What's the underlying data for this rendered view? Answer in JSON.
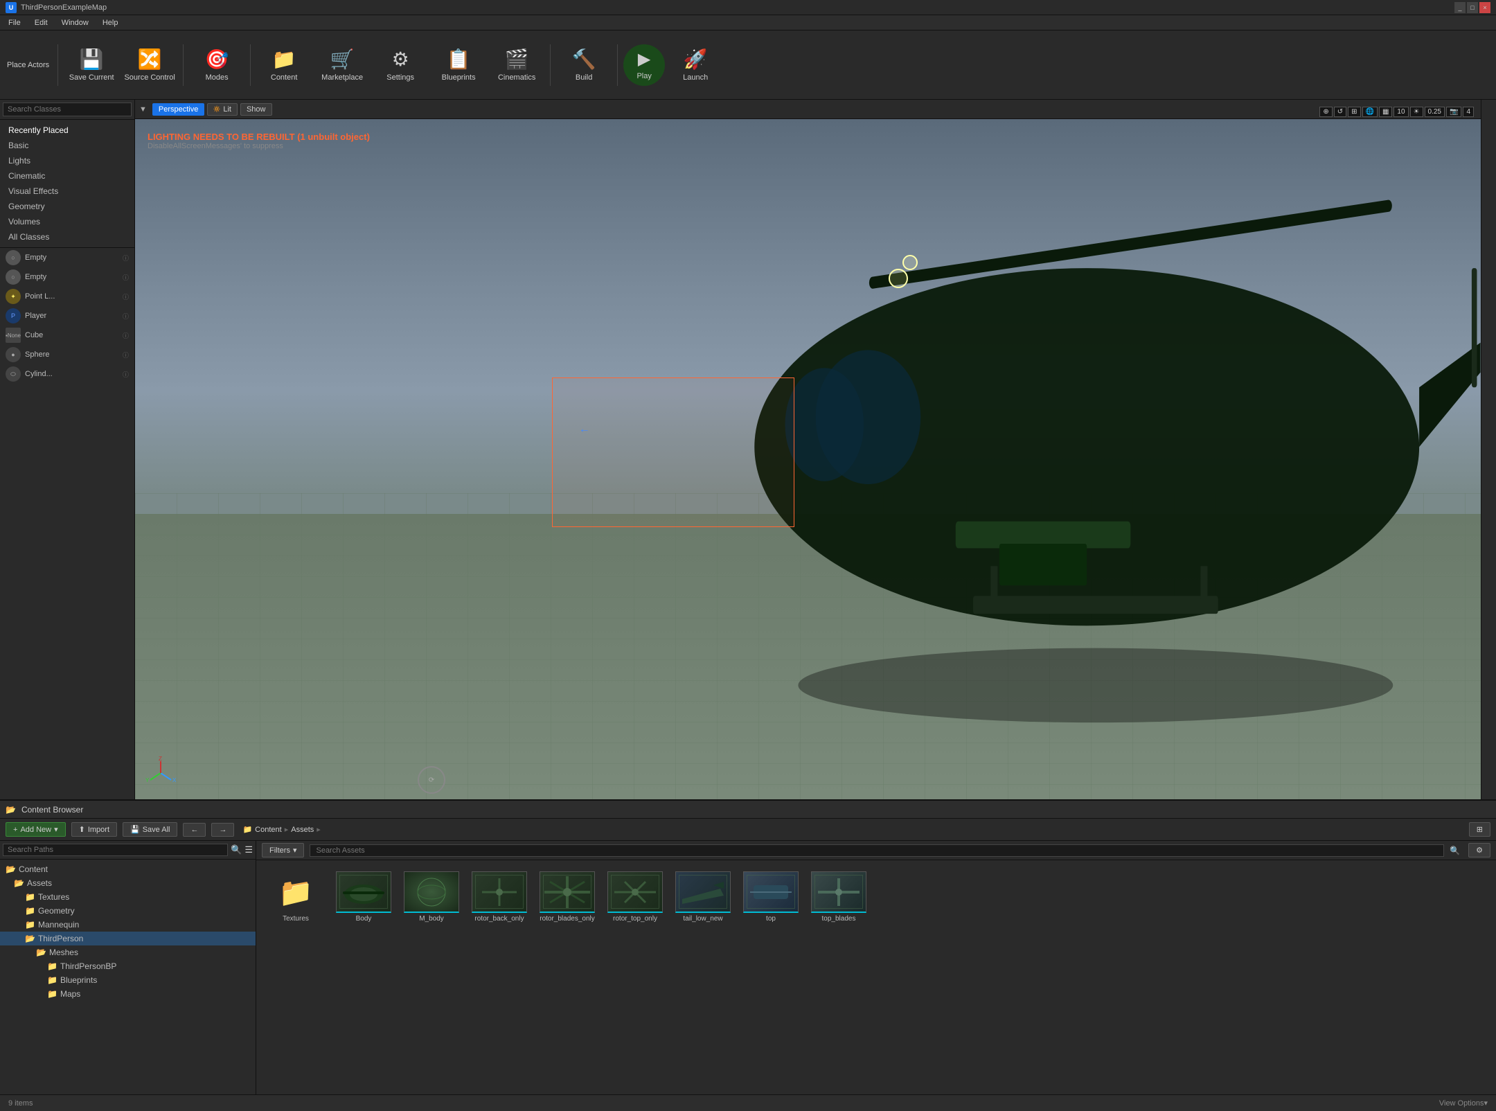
{
  "titlebar": {
    "logo": "UE",
    "title": "ThirdPersonExampleMap",
    "controls": [
      "_",
      "□",
      "×"
    ]
  },
  "menubar": {
    "items": [
      "File",
      "Edit",
      "Window",
      "Help"
    ]
  },
  "toolbar": {
    "place_actors_label": "Place Actors",
    "buttons": [
      {
        "id": "save-current",
        "label": "Save Current",
        "icon": "💾"
      },
      {
        "id": "source-control",
        "label": "Source Control",
        "icon": "🔀"
      },
      {
        "id": "modes",
        "label": "Modes",
        "icon": "🎯"
      },
      {
        "id": "content",
        "label": "Content",
        "icon": "📁"
      },
      {
        "id": "marketplace",
        "label": "Marketplace",
        "icon": "🛒"
      },
      {
        "id": "settings",
        "label": "Settings",
        "icon": "⚙"
      },
      {
        "id": "blueprints",
        "label": "Blueprints",
        "icon": "📋"
      },
      {
        "id": "cinematics",
        "label": "Cinematics",
        "icon": "🎬"
      },
      {
        "id": "build",
        "label": "Build",
        "icon": "🔨"
      },
      {
        "id": "play",
        "label": "Play",
        "icon": "▶"
      },
      {
        "id": "launch",
        "label": "Launch",
        "icon": "🚀"
      }
    ]
  },
  "left_panel": {
    "search_placeholder": "Search Classes",
    "categories": [
      {
        "id": "recently-placed",
        "label": "Recently Placed"
      },
      {
        "id": "basic",
        "label": "Basic"
      },
      {
        "id": "lights",
        "label": "Lights"
      },
      {
        "id": "cinematic",
        "label": "Cinematic"
      },
      {
        "id": "visual-effects",
        "label": "Visual Effects"
      },
      {
        "id": "geometry",
        "label": "Geometry"
      },
      {
        "id": "volumes",
        "label": "Volumes"
      },
      {
        "id": "all-classes",
        "label": "All Classes"
      }
    ],
    "actors": [
      {
        "id": "empty-1",
        "label": "Empty",
        "type": "sphere"
      },
      {
        "id": "empty-2",
        "label": "Empty",
        "type": "sphere"
      },
      {
        "id": "point-light",
        "label": "Point L...",
        "type": "sphere"
      },
      {
        "id": "player",
        "label": "Player",
        "type": "sphere"
      },
      {
        "id": "cube",
        "label": "Cube",
        "type": "cube"
      },
      {
        "id": "sphere",
        "label": "Sphere",
        "type": "sphere"
      },
      {
        "id": "cylinder",
        "label": "Cylind...",
        "type": "sphere"
      }
    ]
  },
  "viewport": {
    "perspective_label": "Perspective",
    "lit_label": "Lit",
    "show_label": "Show",
    "warning_text": "LIGHTING NEEDS TO BE REBUILT (1 unbuilt object)",
    "warning_sub": "DisableAllScreenMessages' to suppress",
    "overlay_values": [
      "10",
      "0.25",
      "4"
    ]
  },
  "content_browser": {
    "title": "Content Browser",
    "add_new_label": "Add New",
    "import_label": "Import",
    "save_all_label": "Save All",
    "filters_label": "Filters",
    "search_paths_placeholder": "Search Paths",
    "search_assets_placeholder": "Search Assets",
    "breadcrumb": [
      "Content",
      "Assets"
    ],
    "folder_tree": [
      {
        "id": "content",
        "label": "Content",
        "indent": 0,
        "expanded": true
      },
      {
        "id": "assets",
        "label": "Assets",
        "indent": 1,
        "expanded": true
      },
      {
        "id": "textures",
        "label": "Textures",
        "indent": 2
      },
      {
        "id": "geometry",
        "label": "Geometry",
        "indent": 2
      },
      {
        "id": "mannequin",
        "label": "Mannequin",
        "indent": 2
      },
      {
        "id": "thirdperson",
        "label": "ThirdPerson",
        "indent": 2,
        "expanded": true
      },
      {
        "id": "meshes",
        "label": "Meshes",
        "indent": 3,
        "expanded": true
      },
      {
        "id": "thirdpersonbp",
        "label": "ThirdPersonBP",
        "indent": 4
      },
      {
        "id": "blueprints",
        "label": "Blueprints",
        "indent": 4
      },
      {
        "id": "maps",
        "label": "Maps",
        "indent": 4
      }
    ],
    "assets": [
      {
        "id": "textures-folder",
        "label": "Textures",
        "type": "folder"
      },
      {
        "id": "body",
        "label": "Body",
        "type": "mesh"
      },
      {
        "id": "m-body",
        "label": "M_body",
        "type": "material"
      },
      {
        "id": "rotor-back-only",
        "label": "rotor_back_only",
        "type": "mesh"
      },
      {
        "id": "rotor-blades-only",
        "label": "rotor_blades_only",
        "type": "mesh"
      },
      {
        "id": "rotor-top-only",
        "label": "rotor_top_only",
        "type": "mesh"
      },
      {
        "id": "tail-low-new",
        "label": "tail_low_new",
        "type": "mesh"
      },
      {
        "id": "top",
        "label": "top",
        "type": "mesh"
      },
      {
        "id": "top-blades",
        "label": "top_blades",
        "type": "mesh"
      }
    ],
    "status": {
      "item_count": "9 items",
      "view_options": "View Options▾"
    }
  }
}
